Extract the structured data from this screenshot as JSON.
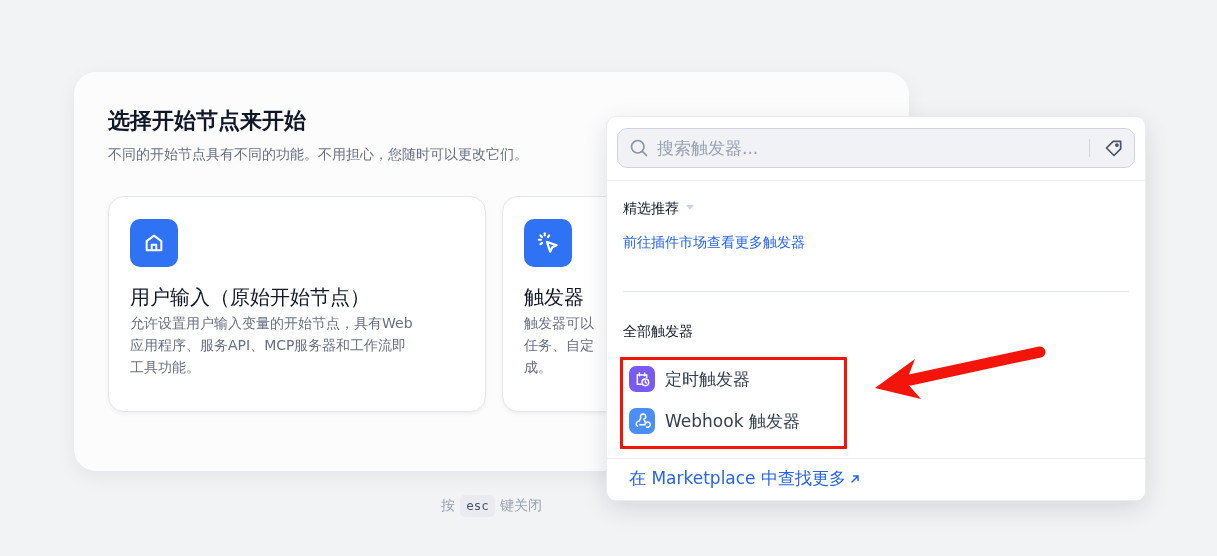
{
  "dialog": {
    "title": "选择开始节点来开始",
    "subtitle": "不同的开始节点具有不同的功能。不用担心，您随时可以更改它们。",
    "options": [
      {
        "kind": "home",
        "title": "用户输入（原始开始节点）",
        "description_lines": [
          "允许设置用户输入变量的开始节点，具有Web",
          "应用程序、服务API、MCP服务器和工作流即",
          "工具功能。"
        ]
      },
      {
        "kind": "trigger",
        "title": "触发器",
        "description_lines": [
          "触发器可以",
          "任务、自定",
          "成。"
        ]
      }
    ]
  },
  "trigger_menu": {
    "search": {
      "placeholder": "搜索触发器..."
    },
    "featured": {
      "heading": "精选推荐",
      "link": "前往插件市场查看更多触发器"
    },
    "all": {
      "heading": "全部触发器",
      "items": [
        {
          "kind": "schedule",
          "label": "定时触发器",
          "color": "#7a5af5"
        },
        {
          "kind": "webhook",
          "label": "Webhook 触发器",
          "color": "#4a8ff7"
        }
      ]
    },
    "footer_link": "在 Marketplace 中查找更多"
  },
  "hint": {
    "before": "按",
    "key": "esc",
    "after": "键关闭"
  }
}
